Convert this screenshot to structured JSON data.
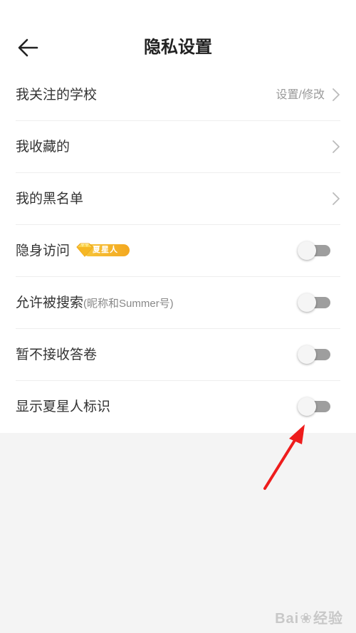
{
  "header": {
    "title": "隐私设置",
    "back_icon": "arrow-left-icon"
  },
  "settings": {
    "followed_school": {
      "label": "我关注的学校",
      "value": "设置/修改",
      "icon": "chevron-right-icon"
    },
    "favorites": {
      "label": "我收藏的",
      "icon": "chevron-right-icon"
    },
    "blacklist": {
      "label": "我的黑名单",
      "icon": "chevron-right-icon"
    },
    "invisible_visit": {
      "label": "隐身访问",
      "badge": "夏星人",
      "badge_icon": "diamond-icon",
      "enabled": false
    },
    "allow_search": {
      "label": "允许被搜索",
      "sublabel": "(昵称和Summer号)",
      "enabled": false
    },
    "no_questionnaire": {
      "label": "暂不接收答卷",
      "enabled": false
    },
    "show_badge": {
      "label": "显示夏星人标识",
      "enabled": false
    }
  },
  "watermark": {
    "text_left": "Bai",
    "text_right": "经验",
    "icon": "paw-icon"
  },
  "colors": {
    "badge_gold": "#f5b82a",
    "toggle_off_track": "#9e9e9e",
    "annotation_red": "#ee1c1c"
  }
}
